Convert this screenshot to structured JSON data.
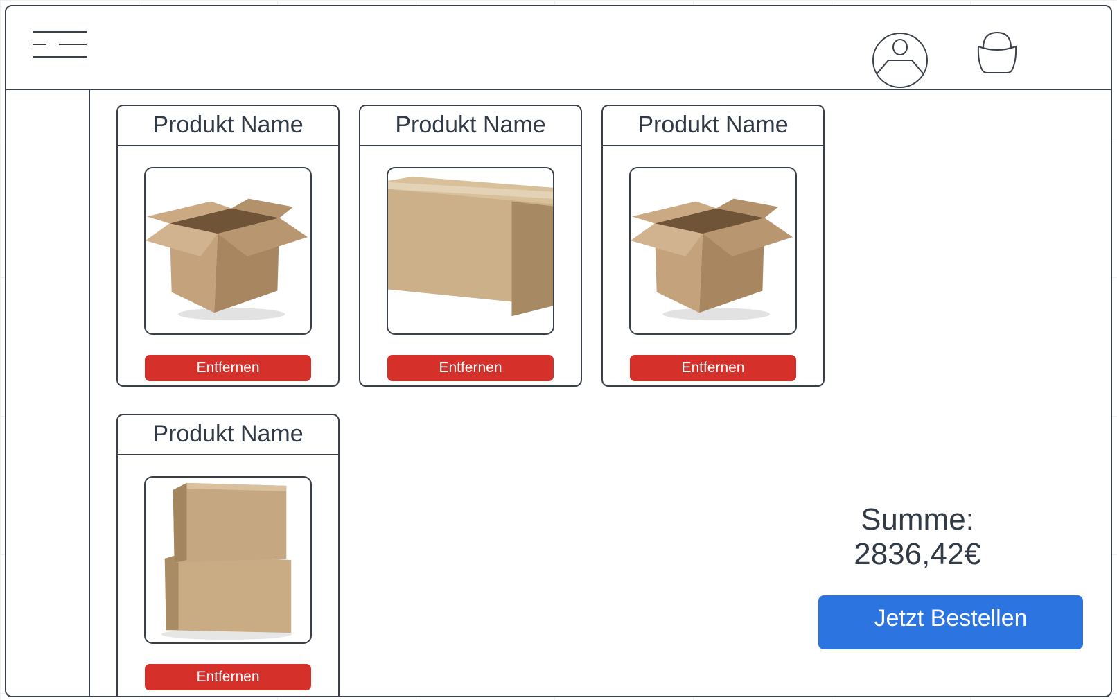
{
  "header": {
    "menu_icon": "hamburger-menu-icon",
    "profile_icon": "user-profile-icon",
    "cart_icon": "shopping-basket-icon"
  },
  "cart": {
    "items": [
      {
        "name": "Produkt Name",
        "image": "open-cardboard-box",
        "remove_label": "Entfernen"
      },
      {
        "name": "Produkt Name",
        "image": "closed-cardboard-box",
        "remove_label": "Entfernen"
      },
      {
        "name": "Produkt Name",
        "image": "open-cardboard-box",
        "remove_label": "Entfernen"
      },
      {
        "name": "Produkt Name",
        "image": "stacked-cardboard-boxes",
        "remove_label": "Entfernen"
      }
    ]
  },
  "summary": {
    "label": "Summe:",
    "total": "2836,42€",
    "order_button": "Jetzt Bestellen"
  },
  "colors": {
    "remove_button": "#d6302a",
    "order_button": "#2c74e0",
    "outline": "#3a4049",
    "text": "#323a46"
  }
}
